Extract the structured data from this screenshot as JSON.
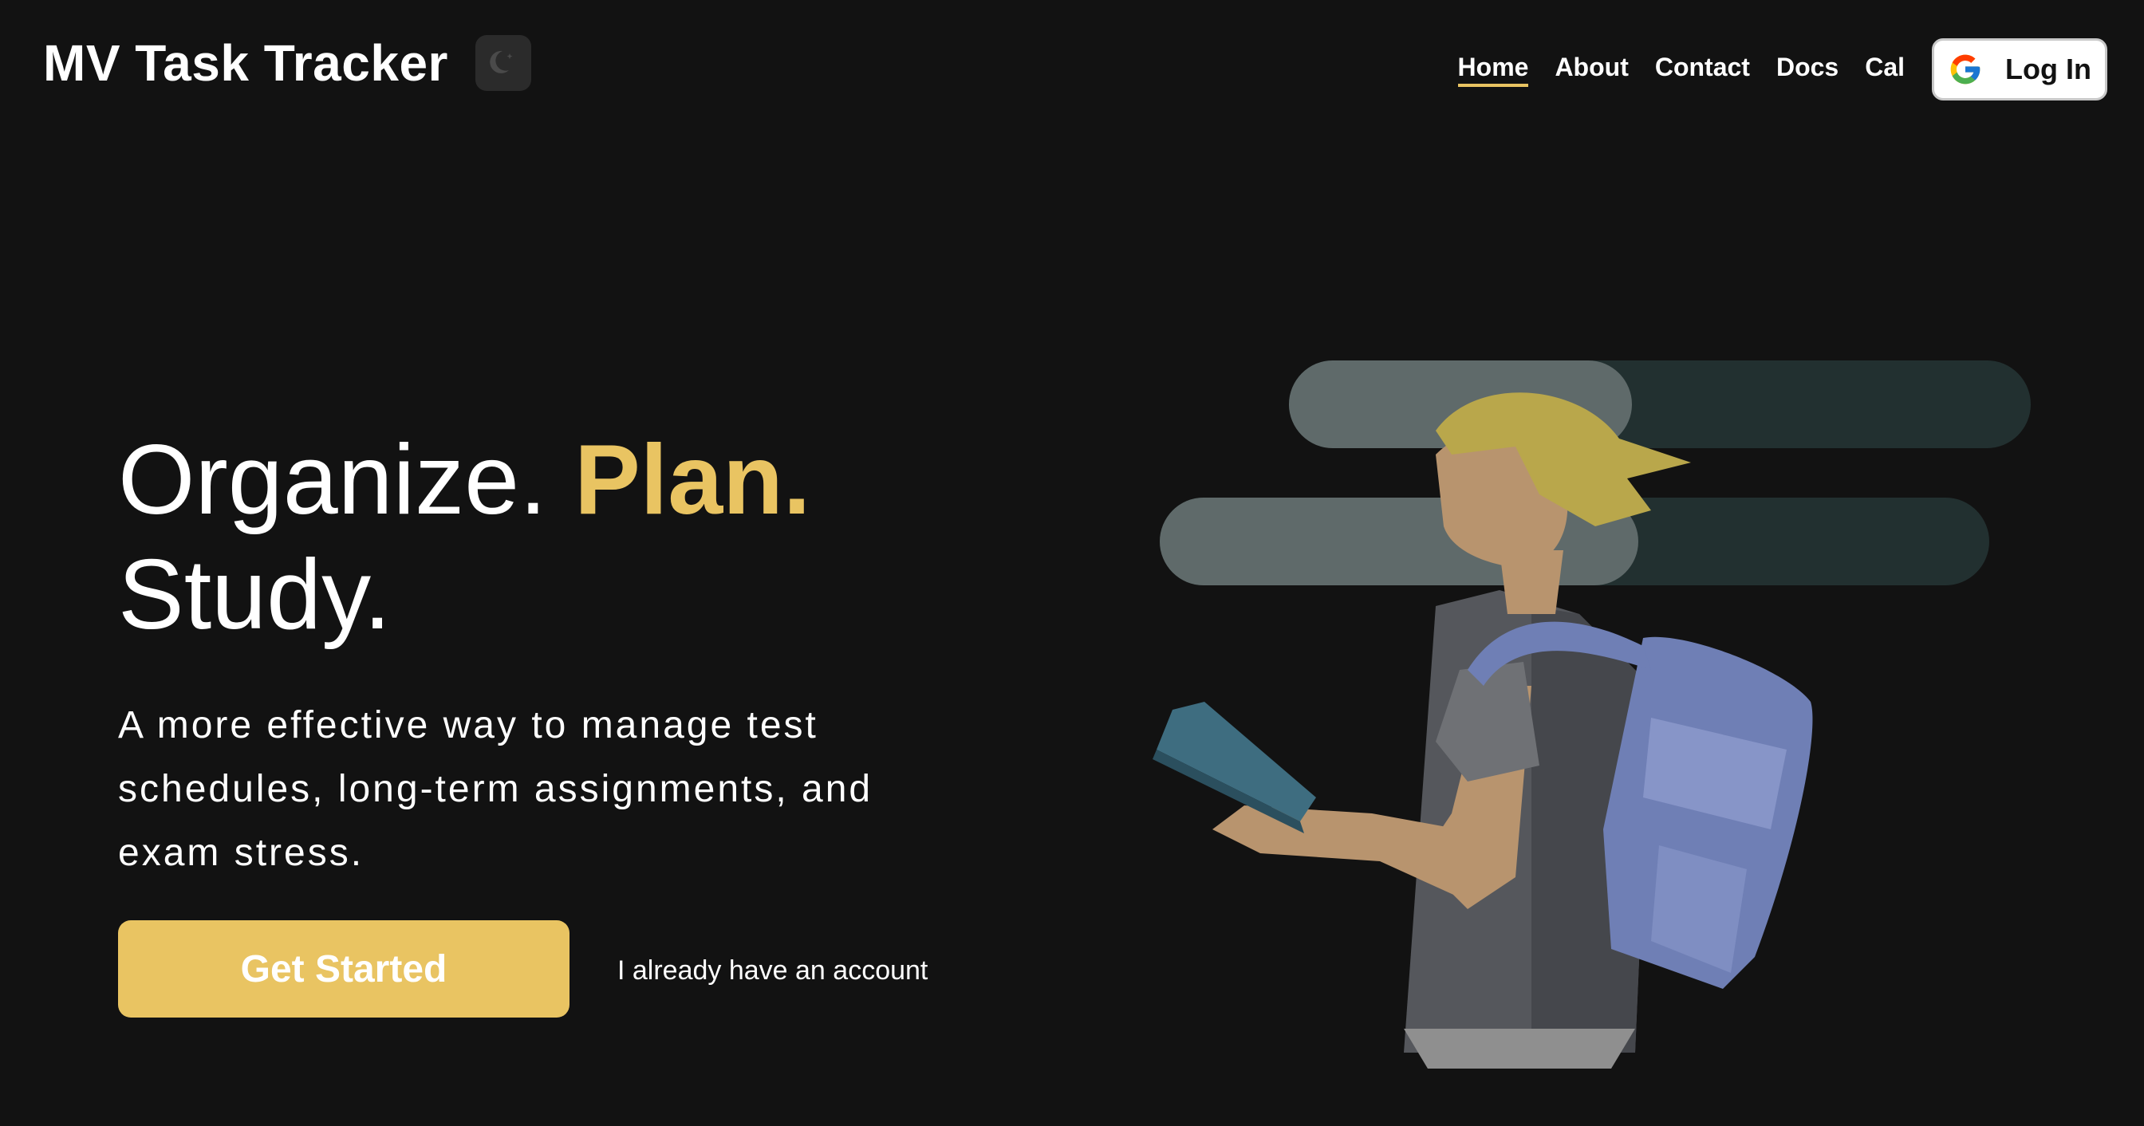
{
  "header": {
    "brand": "MV Task Tracker",
    "theme_toggle_icon": "moon-icon",
    "nav": [
      {
        "label": "Home",
        "active": true
      },
      {
        "label": "About"
      },
      {
        "label": "Contact"
      },
      {
        "label": "Docs"
      },
      {
        "label": "Cal"
      }
    ],
    "login": {
      "icon": "google-icon",
      "label": "Log In"
    }
  },
  "hero": {
    "headline_1": "Organize.",
    "headline_accent": "Plan.",
    "headline_2": "Study.",
    "subtext": "A more effective way to manage test schedules, long-term assignments, and exam stress.",
    "cta_label": "Get Started",
    "secondary_link": "I already have an account"
  },
  "colors": {
    "background": "#121212",
    "accent": "#e9c462",
    "text": "#ffffff"
  }
}
